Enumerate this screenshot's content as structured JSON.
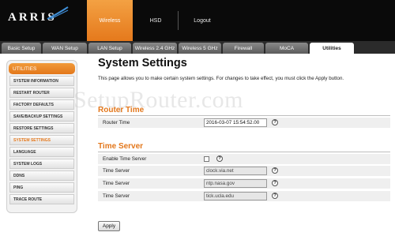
{
  "brand": {
    "logo_text": "ARRIS"
  },
  "topnav": {
    "items": [
      "Wireless",
      "HSD",
      "Logout"
    ],
    "active": "Wireless"
  },
  "subtabs": {
    "items": [
      "Basic Setup",
      "WAN Setup",
      "LAN Setup",
      "Wireless 2.4 GHz",
      "Wireless 5 GHz",
      "Firewall",
      "MoCA",
      "Utilities"
    ],
    "active": "Utilities"
  },
  "sidebar": {
    "heading": "UTILITIES",
    "items": [
      "SYSTEM INFORMATION",
      "RESTART ROUTER",
      "FACTORY DEFAULTS",
      "SAVE/BACKUP SETTINGS",
      "RESTORE SETTINGS",
      "SYSTEM SETTINGS",
      "LANGUAGE",
      "SYSTEM LOGS",
      "DDNS",
      "PING",
      "TRACE ROUTE"
    ],
    "active": "SYSTEM SETTINGS"
  },
  "main": {
    "title": "System Settings",
    "description": "This page allows you to make certain system settings. For changes to take effect, you must click the Apply button.",
    "watermark": "SetupRouter.com",
    "router_time": {
      "heading": "Router Time",
      "label": "Router Time",
      "value": "2016-03-07 15:54:52.00"
    },
    "time_server": {
      "heading": "Time Server",
      "enable_label": "Enable Time Server",
      "enabled": false,
      "rows": [
        {
          "label": "Time Server",
          "value": "clock.via.net"
        },
        {
          "label": "Time Server",
          "value": "ntp.nasa.gov"
        },
        {
          "label": "Time Server",
          "value": "tick.ucla.edu"
        }
      ]
    },
    "help_symbol": "?",
    "apply_label": "Apply"
  },
  "colors": {
    "accent": "#e3771b",
    "header_bg": "#0a0a0a"
  }
}
